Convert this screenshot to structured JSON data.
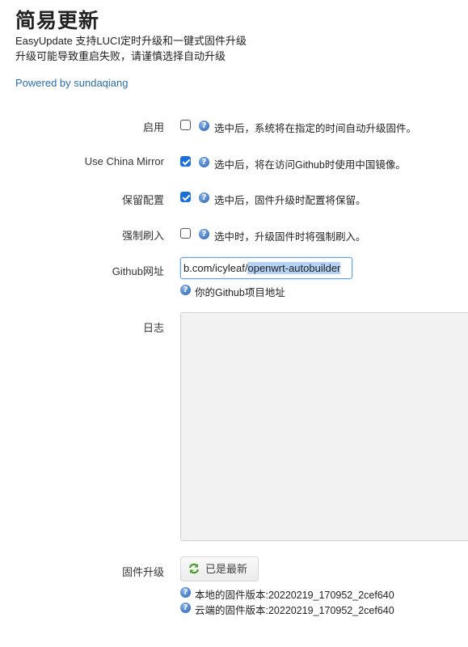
{
  "header": {
    "title": "简易更新",
    "description_line1": "EasyUpdate 支持LUCI定时升级和一键式固件升级",
    "description_line2": "升级可能导致重启失败，请谨慎选择自动升级",
    "powered_by": "Powered by sundaqiang"
  },
  "form": {
    "enable": {
      "label": "启用",
      "checked": false,
      "help": "选中后，系统将在指定的时间自动升级固件。"
    },
    "china_mirror": {
      "label": "Use China Mirror",
      "checked": true,
      "help": "选中后，将在访问Github时使用中国镜像。"
    },
    "keep_config": {
      "label": "保留配置",
      "checked": true,
      "help": "选中后，固件升级时配置将保留。"
    },
    "force_flash": {
      "label": "强制刷入",
      "checked": false,
      "help": "选中时，升级固件时将强制刷入。"
    },
    "github_url": {
      "label": "Github网址",
      "value_visible": "b.com/icyleaf/",
      "value_selected": "openwrt-autobuilder",
      "help": "你的Github项目地址"
    },
    "log": {
      "label": "日志",
      "value": ""
    },
    "firmware": {
      "label": "固件升级",
      "button_label": "已是最新",
      "local_version": "本地的固件版本:20220219_170952_2cef640",
      "cloud_version": "云端的固件版本:20220219_170952_2cef640"
    }
  },
  "colors": {
    "accent": "#1a6fd8",
    "link": "#2a6db3",
    "log_bg": "#f2f2f2"
  }
}
